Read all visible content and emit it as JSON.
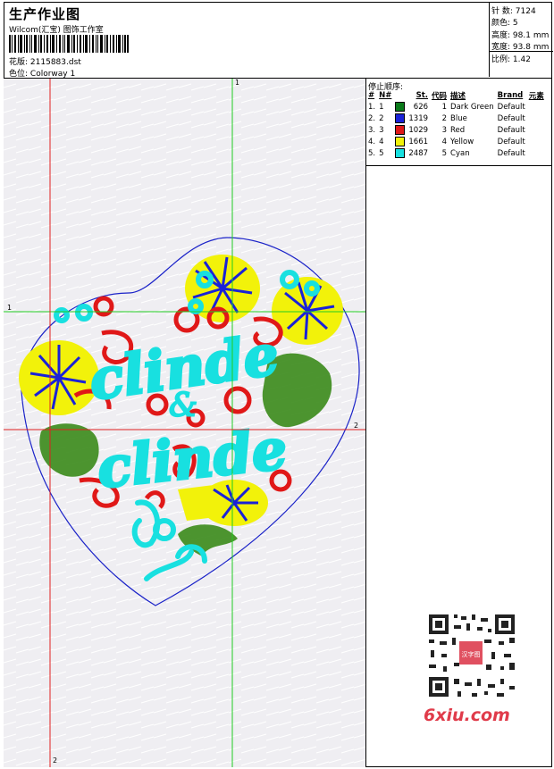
{
  "header": {
    "title": "生产作业图",
    "company": "Wilcom(汇宝) 图饰工作室",
    "file_label": "花版:",
    "file_value": "2115883.dst",
    "colorway_label": "色位:",
    "colorway_value": "Colorway 1"
  },
  "specs": {
    "stitches_label": "针 数:",
    "stitches": "7124",
    "colors_label": "颜色:",
    "colors": "5",
    "height_label": "高度:",
    "height": "98.1 mm",
    "width_label": "宽度:",
    "width": "93.8 mm",
    "ratio_label": "比例:",
    "ratio": "1.42"
  },
  "stop_sequence": {
    "title": "停止顺序:",
    "headers": [
      "#",
      "N#",
      "",
      "St.",
      "代码",
      "描述",
      "Brand",
      "元素"
    ],
    "rows": [
      {
        "num": "1.",
        "n": "1",
        "color": "#0a7a1a",
        "st": "626",
        "code": "1",
        "desc": "Dark Green",
        "brand": "Default"
      },
      {
        "num": "2.",
        "n": "2",
        "color": "#1a22d8",
        "st": "1319",
        "code": "2",
        "desc": "Blue",
        "brand": "Default"
      },
      {
        "num": "3.",
        "n": "3",
        "color": "#e01818",
        "st": "1029",
        "code": "3",
        "desc": "Red",
        "brand": "Default"
      },
      {
        "num": "4.",
        "n": "4",
        "color": "#f2f20a",
        "st": "1661",
        "code": "4",
        "desc": "Yellow",
        "brand": "Default"
      },
      {
        "num": "5.",
        "n": "5",
        "color": "#18e0e0",
        "st": "2487",
        "code": "5",
        "desc": "Cyan",
        "brand": "Default"
      }
    ]
  },
  "guides": {
    "v1": "1",
    "v2": "2",
    "h1": "1",
    "h2": "2"
  },
  "design_text": {
    "line1": "clinde",
    "amp": "&",
    "line2": "clinde"
  },
  "colors": {
    "green": "#3a8a1a",
    "blue": "#1a22d8",
    "red": "#e01818",
    "yellow": "#f2f20a",
    "cyan": "#18e0e0",
    "outline": "#1a22c8",
    "guide_green": "#22cc22",
    "guide_red": "#e02020"
  },
  "watermark": {
    "site": "6xiu.com",
    "stamp": "汉字图"
  }
}
